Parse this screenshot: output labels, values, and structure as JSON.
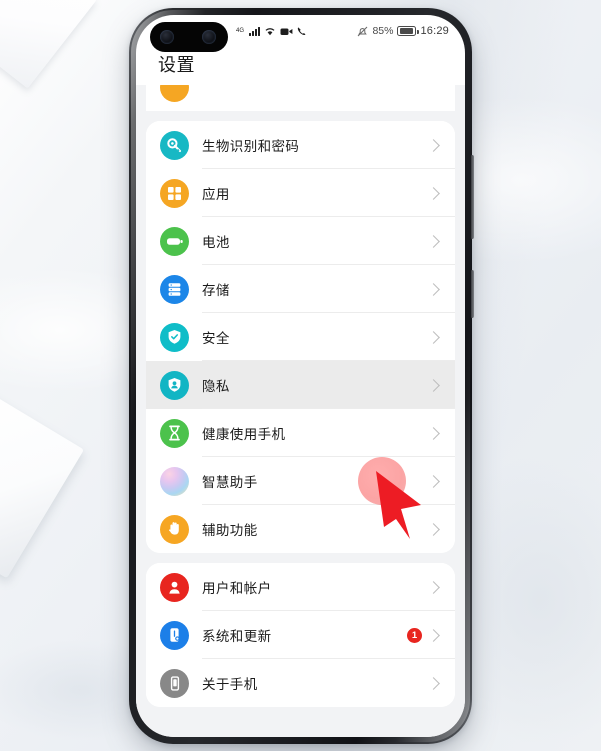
{
  "statusbar": {
    "network_type": "4G",
    "signal_icon": "signal-bars-icon",
    "wifi_icon": "wifi-icon",
    "video_icon": "video-camera-icon",
    "call_icon": "phone-call-icon",
    "mute_icon": "mute-bell-icon",
    "battery_percent": "85%",
    "battery_icon": "battery-icon",
    "clock": "16:29"
  },
  "header": {
    "title": "设置"
  },
  "settings": {
    "sections": [
      {
        "partial_top_item": true,
        "items": [
          {
            "label": "生物识别和密码",
            "icon": "fingerprint-key-icon",
            "color": "#17B8C4",
            "badge": "",
            "selected": false
          },
          {
            "label": "应用",
            "icon": "apps-grid-icon",
            "color": "#F5A623",
            "badge": "",
            "selected": false
          },
          {
            "label": "电池",
            "icon": "battery-icon",
            "color": "#4CC24C",
            "badge": "",
            "selected": false
          },
          {
            "label": "存储",
            "icon": "storage-stack-icon",
            "color": "#1C86E8",
            "badge": "",
            "selected": false
          },
          {
            "label": "安全",
            "icon": "shield-check-icon",
            "color": "#0FBDC8",
            "badge": "",
            "selected": false
          },
          {
            "label": "隐私",
            "icon": "privacy-shield-person-icon",
            "color": "#12B5C4",
            "badge": "",
            "selected": true
          },
          {
            "label": "健康使用手机",
            "icon": "hourglass-icon",
            "color": "#4CC24C",
            "badge": "",
            "selected": false
          },
          {
            "label": "智慧助手",
            "icon": "ai-assistant-sphere-icon",
            "color": "gradient",
            "badge": "",
            "selected": false
          },
          {
            "label": "辅助功能",
            "icon": "hand-accessibility-icon",
            "color": "#F6A623",
            "badge": "",
            "selected": false
          }
        ]
      },
      {
        "partial_top_item": false,
        "items": [
          {
            "label": "用户和帐户",
            "icon": "user-account-icon",
            "color": "#E8251F",
            "badge": "",
            "selected": false
          },
          {
            "label": "系统和更新",
            "icon": "system-update-phone-icon",
            "color": "#1C7FE8",
            "badge": "1",
            "selected": false
          },
          {
            "label": "关于手机",
            "icon": "about-phone-icon",
            "color": "#888888",
            "badge": "",
            "selected": false
          }
        ]
      }
    ],
    "chevron_icon": "chevron-right-icon"
  },
  "overlay": {
    "tap_indicator": "tap-highlight-dot",
    "cursor": "red-arrow-cursor"
  },
  "theme": {
    "badge_red": "#E8251F",
    "selected_row_bg": "#EBEBEB",
    "page_bg": "#F2F3F5"
  }
}
